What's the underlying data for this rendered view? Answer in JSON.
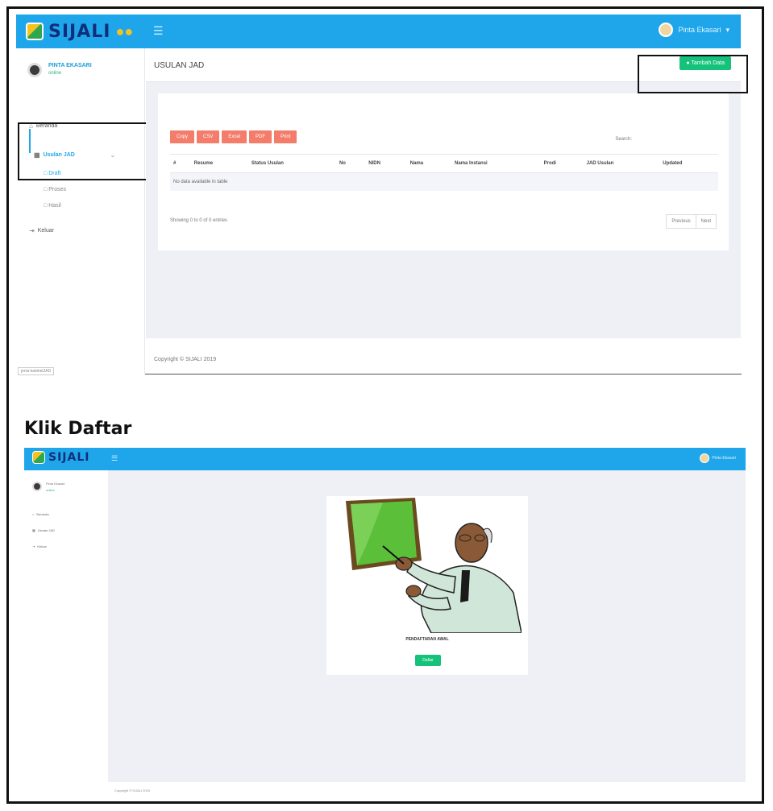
{
  "shot1": {
    "app_name": "SIJALI",
    "user_top": "Pinta Ekasari",
    "profile": {
      "name": "PINTA EKASARI",
      "status": "online"
    },
    "sidebar": [
      {
        "label": "Beranda",
        "icon": "home-icon"
      },
      {
        "label": "Usulan JAD",
        "icon": "grid-icon"
      },
      {
        "label": "Keluar",
        "icon": "logout-icon"
      }
    ],
    "sub_items": [
      "Draft",
      "Proses",
      "Hasil"
    ],
    "version": "jenis:kabinetJAD",
    "page_title": "USULAN JAD",
    "add_button": "Tambah Data",
    "export_buttons": [
      "Copy",
      "CSV",
      "Excel",
      "PDF",
      "Print"
    ],
    "search_label": "Search:",
    "columns": [
      "#",
      "Resume",
      "Status Usulan",
      "No",
      "NIDN",
      "Nama",
      "Nama Instansi",
      "Prodi",
      "JAD Usulan",
      "Updated"
    ],
    "empty_text": "No data available in table",
    "showing": "Showing 0 to 0 of 0 entries",
    "pager": [
      "Previous",
      "Next"
    ],
    "copyright": "Copyright © SIJALI 2019"
  },
  "caption": "Klik Daftar",
  "shot2": {
    "app_name": "SIJALI",
    "user_top": "Pinta Ekasari",
    "profile": {
      "name": "Pinta Ekasari",
      "status": "online"
    },
    "sidebar": [
      "Beranda",
      "Usulan JAD",
      "Keluar"
    ],
    "heading": "PENDAFTARAN AWAL",
    "daftar_button": "Daftar",
    "copyright": "Copyright © SIJALI 2019"
  },
  "colors": {
    "topbar": "#1fa6ea",
    "accent_green": "#15c27a",
    "export_btn": "#f47c6a",
    "bg": "#eef0f6"
  }
}
